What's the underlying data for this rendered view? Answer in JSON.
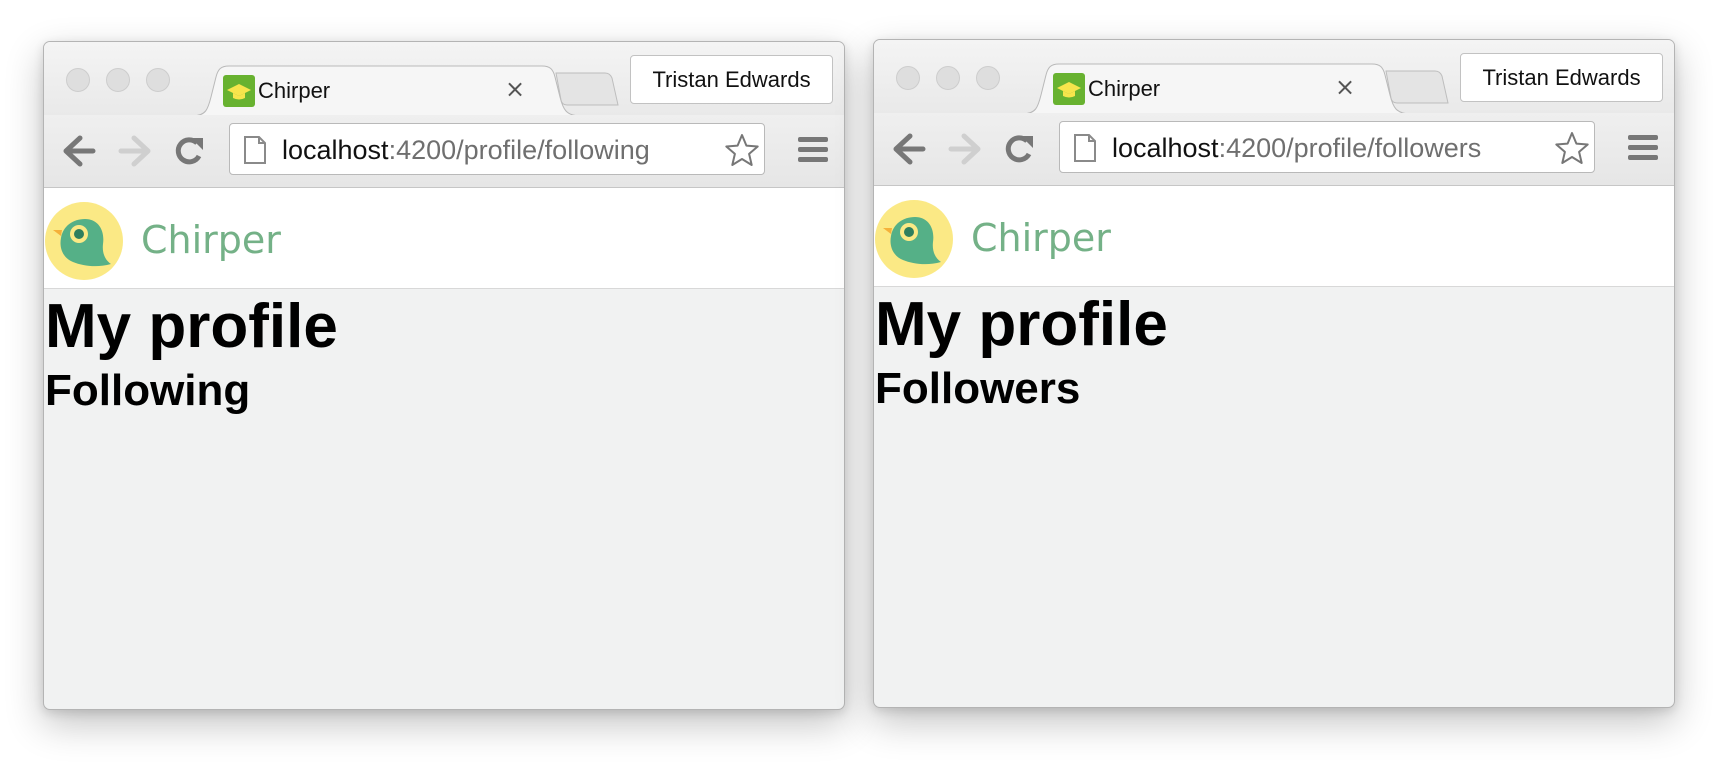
{
  "windows": [
    {
      "tab": {
        "title": "Chirper",
        "close": "×"
      },
      "profile_button": "Tristan Edwards",
      "address": {
        "host": "localhost",
        "path": ":4200/profile/following"
      },
      "app": {
        "brand": "Chirper"
      },
      "page": {
        "title": "My profile",
        "subtitle": "Following"
      }
    },
    {
      "tab": {
        "title": "Chirper",
        "close": "×"
      },
      "profile_button": "Tristan Edwards",
      "address": {
        "host": "localhost",
        "path": ":4200/profile/followers"
      },
      "app": {
        "brand": "Chirper"
      },
      "page": {
        "title": "My profile",
        "subtitle": "Followers"
      }
    }
  ],
  "icons": {
    "favicon": "graduation-cap-icon",
    "back": "arrow-left-icon",
    "forward": "arrow-right-icon",
    "reload": "reload-icon",
    "page": "page-icon",
    "bookmark": "star-icon",
    "menu": "hamburger-menu-icon",
    "logo": "chirper-bird-logo"
  },
  "colors": {
    "brand_text": "#74b187",
    "logo_bg": "#fbe985",
    "logo_bird": "#55b087",
    "favicon_bg": "#68b230",
    "page_bg": "#f1f2f2"
  }
}
